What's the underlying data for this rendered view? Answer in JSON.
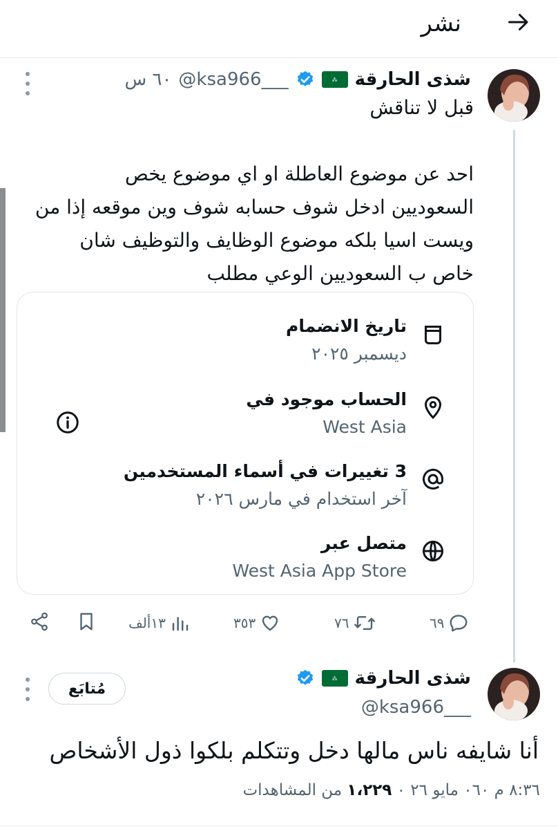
{
  "header": {
    "title": "نشر",
    "back_icon": "arrow-right-icon"
  },
  "post1": {
    "name": "شذى الحارقة",
    "handle": "@ksa966___",
    "time": "٦٠ س",
    "text": "قبل لا تناقش\n\nاحد عن موضوع العاطلة او اي موضوع يخص\nالسعوديين ادخل شوف حسابه شوف وين موقعه إذا من\nويست اسيا بلكه موضوع الوظايف والتوظيف شان\nخاص ب السعوديين الوعي مطلب",
    "card": {
      "items": [
        {
          "icon": "calendar-icon",
          "title": "تاريخ الانضمام",
          "sub": "ديسمبر ٢٠٢٥"
        },
        {
          "icon": "location-pin-icon",
          "title": "الحساب موجود في",
          "sub": "West Asia"
        },
        {
          "icon": "at-sign-icon",
          "title": "3 تغييرات في أسماء المستخدمين",
          "sub": "آخر استخدام في مارس ٢٠٢٦"
        },
        {
          "icon": "globe-icon",
          "title": "متصل عبر",
          "sub": "West Asia App Store"
        }
      ]
    },
    "actions": {
      "replies": "٦٩",
      "reposts": "٧٦",
      "likes": "٣٥٣",
      "views": "١٣ألف"
    }
  },
  "post2": {
    "name": "شذى الحارقة",
    "handle": "@ksa966___",
    "follow_label": "مُتابَع",
    "text": "أنا شايفه ناس مالها دخل وتتكلم بلكوا ذول الأشخاص",
    "time": "٨:٣٦ م ٠٦٠ مايو ٢٦ ٠",
    "views_count": "١،٢٢٩",
    "views_label": "من المشاهدات"
  },
  "colors": {
    "accent": "#1d9bf0",
    "flag": "#006c35",
    "muted": "#536471",
    "text": "#0f1419"
  }
}
